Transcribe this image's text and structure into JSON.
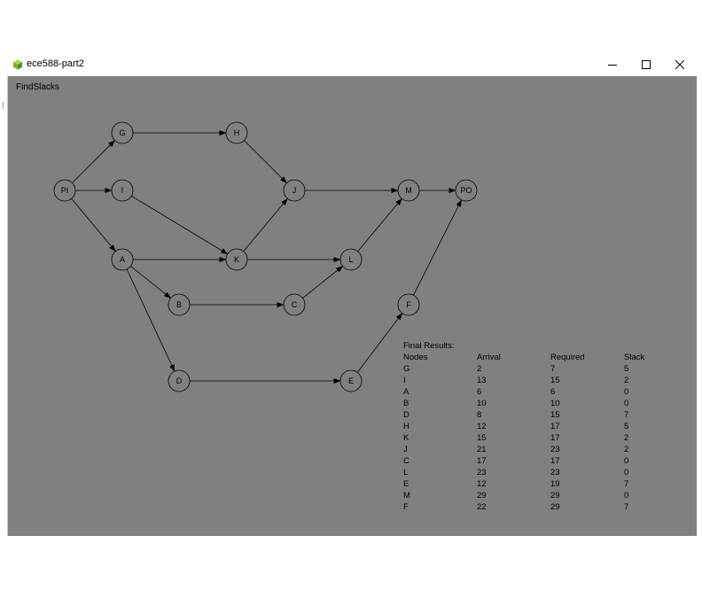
{
  "window": {
    "title": "ece588-part2",
    "controls": [
      "minimize-icon",
      "maximize-icon",
      "close-icon"
    ]
  },
  "toolbar": {
    "find_slacks_label": "FindSlacks"
  },
  "graph": {
    "nodes": [
      "PI",
      "G",
      "I",
      "A",
      "H",
      "K",
      "B",
      "D",
      "J",
      "C",
      "L",
      "E",
      "M",
      "F",
      "PO"
    ]
  },
  "results": {
    "title": "Final Results:",
    "headers": [
      "Nodes",
      "Arrival",
      "Required",
      "Slack"
    ],
    "rows": [
      [
        "G",
        "2",
        "7",
        "5"
      ],
      [
        "I",
        "13",
        "15",
        "2"
      ],
      [
        "A",
        "6",
        "6",
        "0"
      ],
      [
        "B",
        "10",
        "10",
        "0"
      ],
      [
        "D",
        "8",
        "15",
        "7"
      ],
      [
        "H",
        "12",
        "17",
        "5"
      ],
      [
        "K",
        "15",
        "17",
        "2"
      ],
      [
        "J",
        "21",
        "23",
        "2"
      ],
      [
        "C",
        "17",
        "17",
        "0"
      ],
      [
        "L",
        "23",
        "23",
        "0"
      ],
      [
        "E",
        "12",
        "19",
        "7"
      ],
      [
        "M",
        "29",
        "29",
        "0"
      ],
      [
        "F",
        "22",
        "29",
        "7"
      ]
    ]
  }
}
